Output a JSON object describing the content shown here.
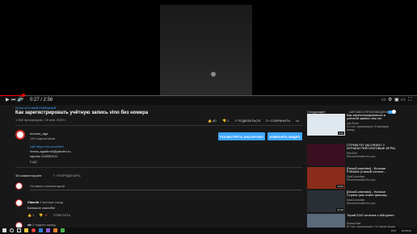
{
  "player": {
    "time": "0:27 / 2:56",
    "progress_fraction": 0.16,
    "settings_icon": "gear-icon"
  },
  "video": {
    "category_tag": "#Vinо #Сoчный #Хабарный",
    "title": "Как зарегистрировать учётную запись vino без номера",
    "stats": "1 500 просмотров • 20 янв. 2020 г.",
    "likes": "40",
    "dislikes": "1",
    "share": "ПОДЕЛИТЬСЯ",
    "save": "СОХРАНИТЬ"
  },
  "channel": {
    "name": "rimoser_aga",
    "subs": "140 подписчиков",
    "analytics_button": "ПОСМОТРЕТЬ АНАЛИТИКУ",
    "edit_button": "ИЗМЕНИТЬ ВИДЕО"
  },
  "description": {
    "lines": [
      "caill https://vk.com/usr0",
      "rimmo-agadirnoi@yandex.ru",
      "пароль Zx2000121",
      "ЕЩЁ"
    ]
  },
  "comments": {
    "count": "35 комментариев",
    "sort": "УПОРЯДОЧИТЬ",
    "add_placeholder": "Оставьте комментарий",
    "items": [
      {
        "author": "Vlasnik",
        "time": "2 месяца назад",
        "text": "Большое спасибо!",
        "likes": "1",
        "reply": "ОТВЕТИТЬ"
      },
      {
        "author": "vlr",
        "time": "2 недели назад",
        "text": ""
      }
    ]
  },
  "sidebar": {
    "heading": "Следующее",
    "autoplay_label": "АВТОВОСПРОИЗВЕДЕНИЕ",
    "items": [
      {
        "title": "Как зарегистрироваться в учётной записи vino vin",
        "meta1": "Ask Rone",
        "meta2": "21 тыс. просмотров • 8 месяцев назад",
        "duration": "5:25",
        "thumb_color": "#dfe7ef"
      },
      {
        "title": "СТРИМ ПО VALORANT // ИГРАЕМ РЕЙТИНГОВЫЕ ИГРЫ",
        "meta1": "Red Bot",
        "meta2": "Recommended for you",
        "duration": "",
        "thumb_color": "#3a1020"
      },
      {
        "title": "[DeadComedian] - Больше РЭКАКА (Самый личное...",
        "meta1": "DadComedian",
        "meta2": "Recommended for you",
        "duration": "16:52",
        "thumb_color": "#8a2c1a"
      },
      {
        "title": "[DeadComedian] - Ночные Страхи (как отмет фильму...",
        "meta1": "DadComedian",
        "meta2": "Recommended for you",
        "duration": "32:10",
        "thumb_color": "#2a2f36"
      },
      {
        "title": "Торий 2110 оптичка с АВтурнеи",
        "meta1": "Kufana Bar",
        "meta2": "87 тыс. просмотров • 14 часов назад",
        "duration": "",
        "thumb_color": "#5a6a7a"
      }
    ]
  },
  "taskbar": {
    "locale": "РУС",
    "time": "16:05:33"
  }
}
